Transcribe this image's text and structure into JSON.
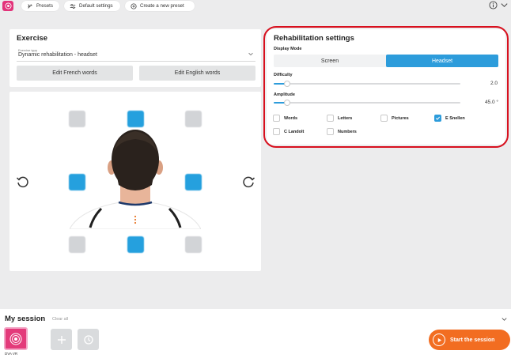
{
  "topbar": {
    "presets_label": "Presets",
    "default_settings_label": "Default settings",
    "create_preset_label": "Create a new preset"
  },
  "exercise": {
    "title": "Exercise",
    "type_label": "Exercise type",
    "type_value": "Dynamic rehabilitation - headset",
    "edit_french_label": "Edit French words",
    "edit_english_label": "Edit English words"
  },
  "rehab": {
    "title": "Rehabilitation settings",
    "display_mode_label": "Display Mode",
    "display_modes": [
      {
        "label": "Screen",
        "active": false
      },
      {
        "label": "Headset",
        "active": true
      }
    ],
    "difficulty_label": "Difficulty",
    "difficulty_value": "2.0",
    "difficulty_fraction": 0.07,
    "amplitude_label": "Amplitude",
    "amplitude_value": "45.0 °",
    "amplitude_fraction": 0.07,
    "options": [
      {
        "label": "Words",
        "checked": false
      },
      {
        "label": "Letters",
        "checked": false
      },
      {
        "label": "Pictures",
        "checked": false
      },
      {
        "label": "E Snellen",
        "checked": true
      },
      {
        "label": "C Landolt",
        "checked": false
      },
      {
        "label": "Numbers",
        "checked": false
      }
    ],
    "outline_color": "#d8101e"
  },
  "session": {
    "title": "My session",
    "clear_all_label": "Clear all",
    "card_label": "DVA VR",
    "start_label": "Start the session"
  },
  "colors": {
    "accent_blue": "#2d9cdb",
    "brand_pink": "#e2337a",
    "start_orange": "#f26d21"
  }
}
